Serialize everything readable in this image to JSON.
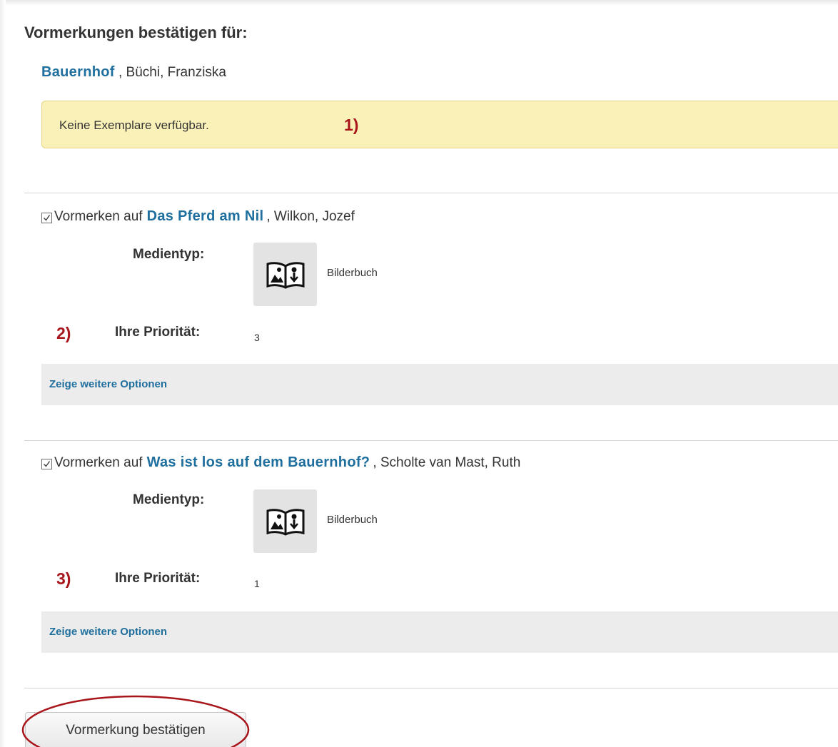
{
  "heading": "Vormerkungen bestätigen für:",
  "requested_title": {
    "title": "Bauernhof",
    "author_suffix": ", Büchi, Franziska"
  },
  "alert": {
    "text": "Keine Exemplare verfügbar.",
    "marker": "1)"
  },
  "items": [
    {
      "checked": true,
      "prefix": "Vormerken auf",
      "title": "Das Pferd am Nil",
      "author_suffix": ", Wilkon, Jozef",
      "media_label": "Medientyp:",
      "media_type": "Bilderbuch",
      "priority_label": "Ihre Priorität:",
      "priority": "3",
      "marker": "2)",
      "options_link": "Zeige weitere Optionen"
    },
    {
      "checked": true,
      "prefix": "Vormerken auf",
      "title": "Was ist los auf dem Bauernhof?",
      "author_suffix": ", Scholte van Mast, Ruth",
      "media_label": "Medientyp:",
      "media_type": "Bilderbuch",
      "priority_label": "Ihre Priorität:",
      "priority": "1",
      "marker": "3)",
      "options_link": "Zeige weitere Optionen"
    }
  ],
  "confirm_button": "Vormerkung bestätigen",
  "colors": {
    "link": "#1f6f9e",
    "marker": "#a8161b",
    "alert_bg": "#faf1b8",
    "options_bg": "#ececec",
    "annotation_circle": "#a8161b"
  },
  "icons": {
    "media": "picture-book-icon",
    "checkbox": "checkmark-icon"
  }
}
